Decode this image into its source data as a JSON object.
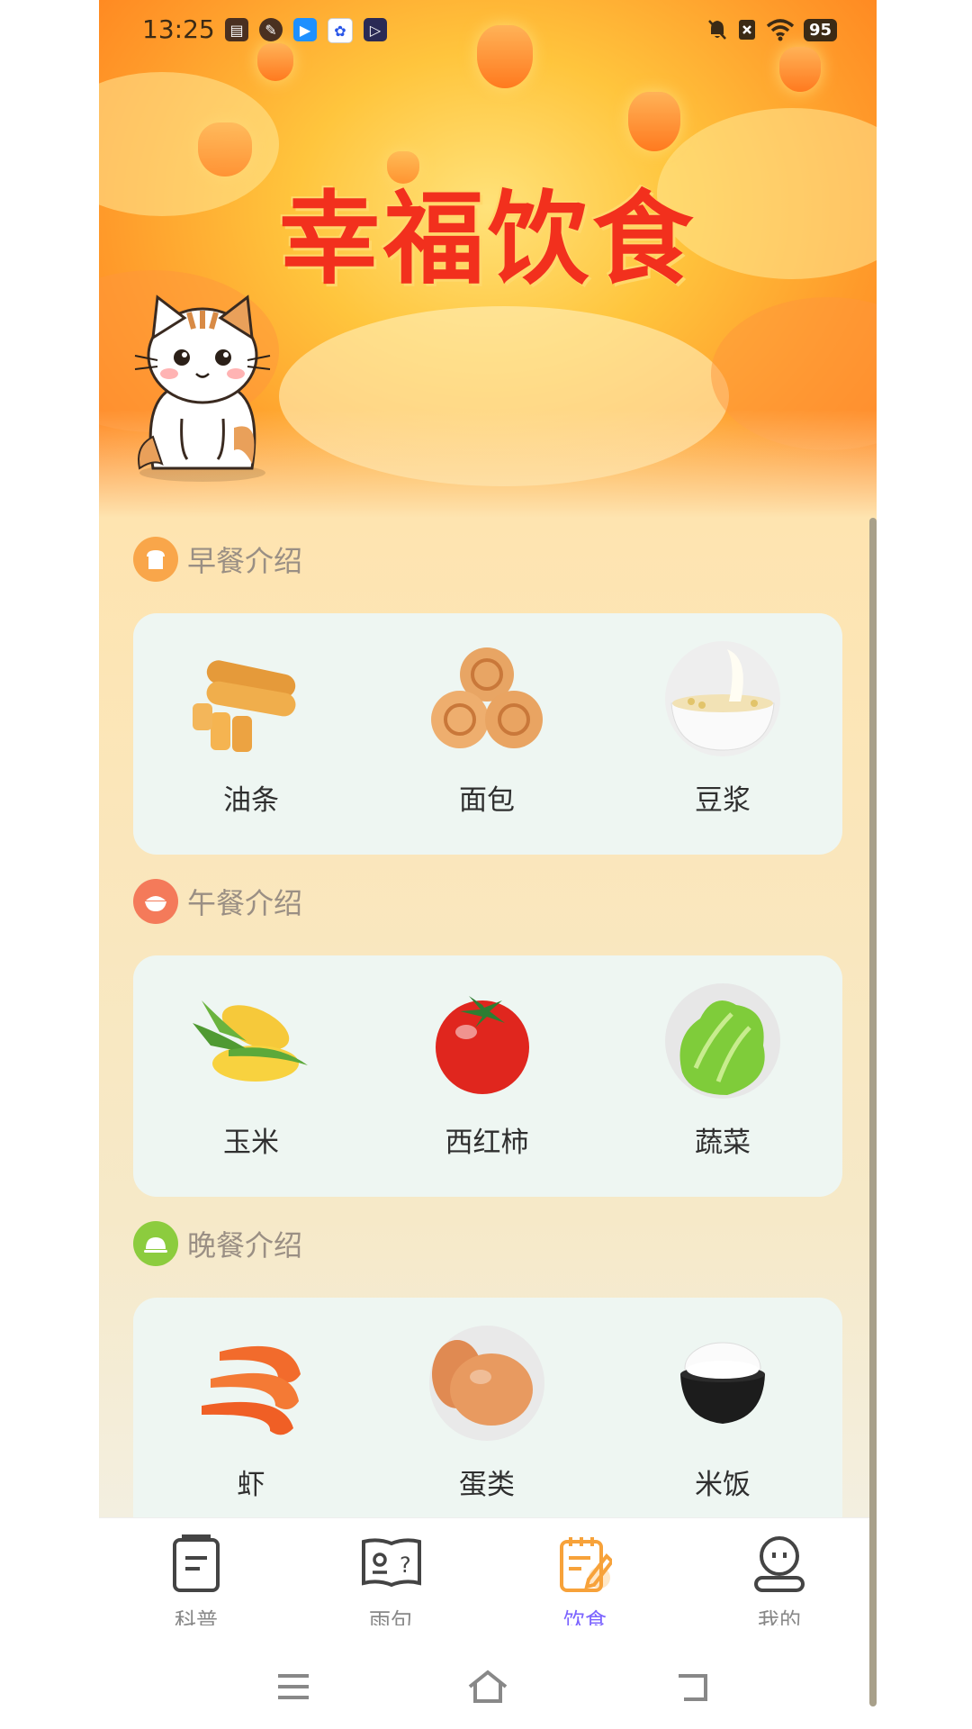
{
  "status_bar": {
    "time": "13:25",
    "battery": "95",
    "icons": [
      "calendar-icon",
      "leaf-icon",
      "video-icon",
      "baidu-icon",
      "play-icon"
    ]
  },
  "banner": {
    "title": "幸福饮食"
  },
  "sections": [
    {
      "title": "早餐介绍",
      "icon": "bread-icon",
      "icon_color": "#f9a64a",
      "items": [
        {
          "label": "油条",
          "icon": "youtiao-icon"
        },
        {
          "label": "面包",
          "icon": "bread-rolls-icon"
        },
        {
          "label": "豆浆",
          "icon": "soymilk-icon"
        }
      ]
    },
    {
      "title": "午餐介绍",
      "icon": "rice-bowl-icon",
      "icon_color": "#f47a5a",
      "items": [
        {
          "label": "玉米",
          "icon": "corn-icon"
        },
        {
          "label": "西红柿",
          "icon": "tomato-icon"
        },
        {
          "label": "蔬菜",
          "icon": "lettuce-icon"
        }
      ]
    },
    {
      "title": "晚餐介绍",
      "icon": "dish-cover-icon",
      "icon_color": "#8ccc3e",
      "items": [
        {
          "label": "虾",
          "icon": "shrimp-icon"
        },
        {
          "label": "蛋类",
          "icon": "egg-icon"
        },
        {
          "label": "米饭",
          "icon": "rice-icon"
        }
      ]
    }
  ],
  "nav": {
    "items": [
      {
        "label": "科普",
        "icon": "document-icon"
      },
      {
        "label": "雨句",
        "icon": "book-question-icon"
      },
      {
        "label": "饮食",
        "icon": "notes-edit-icon",
        "active": true
      },
      {
        "label": "我的",
        "icon": "profile-icon"
      }
    ],
    "active_color": "#7b63ff"
  }
}
